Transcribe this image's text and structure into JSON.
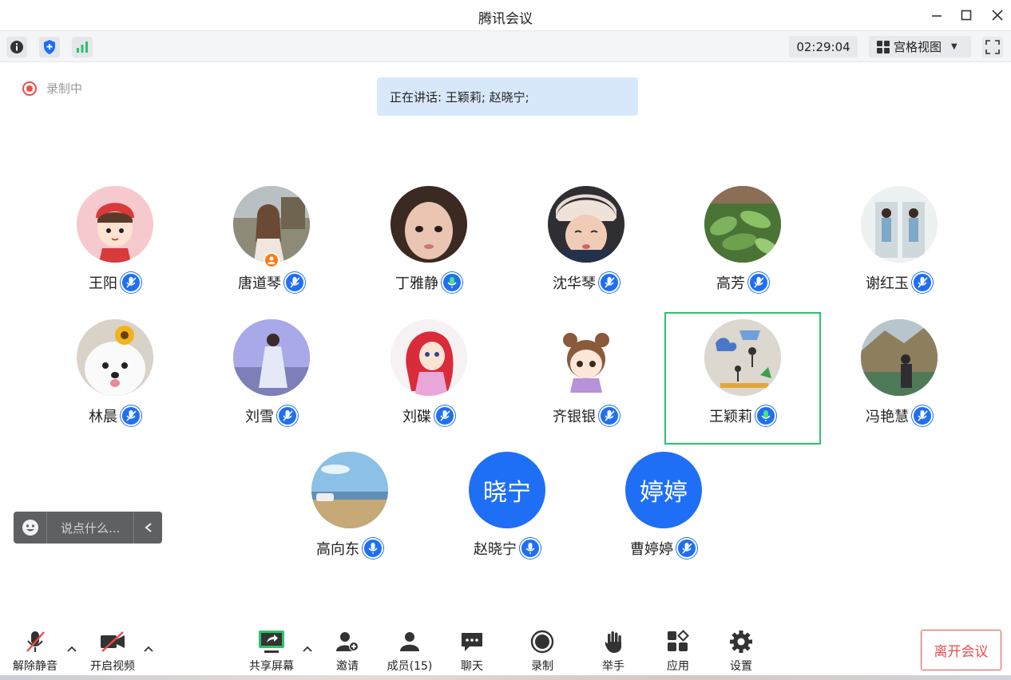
{
  "window": {
    "title": "腾讯会议"
  },
  "toolbar": {
    "timer": "02:29:04",
    "view_label": "宫格视图"
  },
  "recording": {
    "label": "录制中"
  },
  "speaking": {
    "text": "正在讲话: 王颖莉; 赵晓宁;"
  },
  "participants": [
    {
      "name": "王阳",
      "mic": "muted",
      "avatar": "cartoon-girl"
    },
    {
      "name": "唐道琴",
      "mic": "muted",
      "avatar": "photo",
      "host": true
    },
    {
      "name": "丁雅静",
      "mic": "active-green",
      "avatar": "photo"
    },
    {
      "name": "沈华琴",
      "mic": "muted",
      "avatar": "photo"
    },
    {
      "name": "高芳",
      "mic": "muted",
      "avatar": "plants"
    },
    {
      "name": "谢红玉",
      "mic": "muted",
      "avatar": "photo"
    },
    {
      "name": "林晨",
      "mic": "muted",
      "avatar": "dog"
    },
    {
      "name": "刘雪",
      "mic": "muted",
      "avatar": "photo"
    },
    {
      "name": "刘碟",
      "mic": "muted",
      "avatar": "cartoon-mermaid"
    },
    {
      "name": "齐银银",
      "mic": "muted",
      "avatar": "cartoon-girl"
    },
    {
      "name": "王颖莉",
      "mic": "active-green",
      "avatar": "drawing",
      "speaking": true
    },
    {
      "name": "冯艳慧",
      "mic": "muted",
      "avatar": "photo"
    },
    {
      "name": "高向东",
      "mic": "on",
      "avatar": "beach"
    },
    {
      "name": "赵晓宁",
      "mic": "on",
      "avatar_text": "晓宁"
    },
    {
      "name": "曹婷婷",
      "mic": "muted",
      "avatar_text": "婷婷"
    }
  ],
  "chat": {
    "placeholder": "说点什么..."
  },
  "bottombar": {
    "unmute": "解除静音",
    "video": "开启视频",
    "share": "共享屏幕",
    "invite": "邀请",
    "members": "成员(15)",
    "chat": "聊天",
    "record": "录制",
    "raise_hand": "举手",
    "apps": "应用",
    "settings": "设置",
    "leave": "离开会议"
  },
  "colors": {
    "accent": "#1e6ff5",
    "speaking_border": "#2dc26b",
    "leave": "#ee4b4b",
    "rec": "#f14b4b"
  }
}
